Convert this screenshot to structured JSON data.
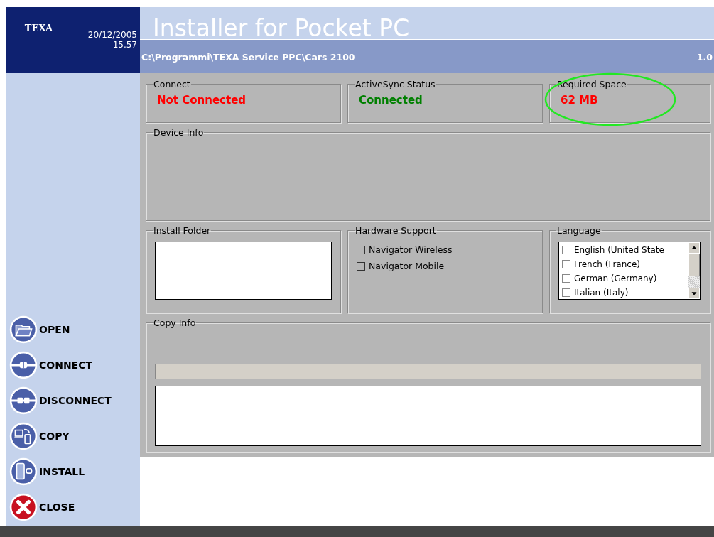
{
  "header": {
    "logo": "TEXA",
    "date": "20/12/2005",
    "time": "15.57",
    "title": "Installer for Pocket PC",
    "path": "C:\\Programmi\\TEXA Service PPC\\Cars 2100",
    "version": "1.0"
  },
  "sidebar": {
    "buttons": [
      {
        "label": "OPEN",
        "kind": "open"
      },
      {
        "label": "CONNECT",
        "kind": "connect"
      },
      {
        "label": "DISCONNECT",
        "kind": "disconnect"
      },
      {
        "label": "COPY",
        "kind": "copy"
      },
      {
        "label": "INSTALL",
        "kind": "install"
      },
      {
        "label": "CLOSE",
        "kind": "close"
      }
    ]
  },
  "status": [
    {
      "title": "Connect",
      "value": "Not Connected",
      "color": "#ff0000",
      "highlighted": false
    },
    {
      "title": "ActiveSync Status",
      "value": "Connected",
      "color": "#008000",
      "highlighted": false
    },
    {
      "title": "Required Space",
      "value": "62 MB",
      "color": "#ff0000",
      "highlighted": true
    }
  ],
  "device_info": {
    "title": "Device Info"
  },
  "install_folder": {
    "title": "Install Folder"
  },
  "hardware_support": {
    "title": "Hardware Support",
    "options": [
      {
        "label": "Navigator Wireless",
        "checked": false
      },
      {
        "label": "Navigator Mobile",
        "checked": false
      }
    ]
  },
  "language": {
    "title": "Language",
    "options": [
      {
        "label": "English (United State",
        "checked": false
      },
      {
        "label": "French (France)",
        "checked": false
      },
      {
        "label": "German (Germany)",
        "checked": false
      },
      {
        "label": "Italian (Italy)",
        "checked": false
      }
    ]
  },
  "copy_info": {
    "title": "Copy Info",
    "level": 0
  }
}
